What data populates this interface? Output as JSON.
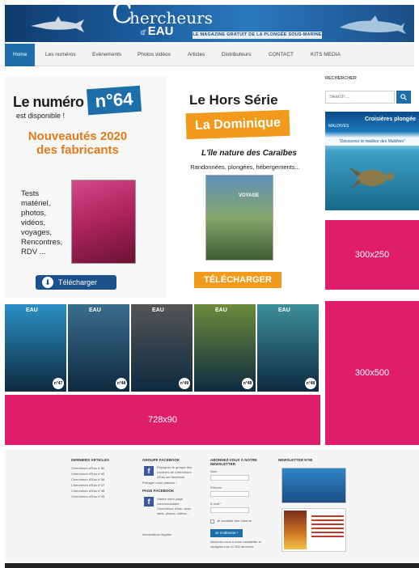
{
  "header": {
    "logo_c": "C",
    "logo_top": "hercheurs",
    "logo_small": "d'",
    "logo_bottom": "EAU",
    "tagline": "LE MAGAZINE GRATUIT DE LA PLONGÉE SOUS-MARINE"
  },
  "nav": {
    "items": [
      {
        "label": "Home"
      },
      {
        "label": "Les numéros"
      },
      {
        "label": "Evénements"
      },
      {
        "label": "Photos vidéos"
      },
      {
        "label": "Articles"
      },
      {
        "label": "Distributeurs"
      },
      {
        "label": "CONTACT"
      },
      {
        "label": "KITS MEDIA"
      }
    ]
  },
  "promo1": {
    "title": "Le numéro",
    "number": "n°64",
    "available": "est disponible !",
    "headline": "Nouveautés 2020 des fabricants",
    "tests": "Tests matériel, photos, vidéos, voyages, Rencontres, RDV ...",
    "download": "Télécharger"
  },
  "promo2": {
    "title": "Le Hors Série",
    "destination": "La Dominique",
    "subtitle": "L'île nature des Caraïbes",
    "topics": "Randonnées, plongées, hébergements...",
    "cover_label": "VOYAGE",
    "download": "TÉLÉCHARGER"
  },
  "sidebar": {
    "search_title": "RECHERCHER",
    "search_placeholder": "Search ...",
    "maldives_title": "Croisières plongée",
    "maldives_sub": "MALDIVES",
    "maldives_band": "\"Découvrez le meilleur des Maldives\""
  },
  "ads": {
    "ad1": "300x250",
    "ad2": "300x500",
    "ad3": "728x90"
  },
  "covers": [
    {
      "logo": "EAU",
      "num": "n°47",
      "color": "#2a8fc4"
    },
    {
      "logo": "EAU",
      "num": "n°48",
      "color": "#3a6d8e"
    },
    {
      "logo": "EAU",
      "num": "n°49",
      "color": "#555555"
    },
    {
      "logo": "EAU",
      "num": "n°48",
      "color": "#6c8b3a"
    },
    {
      "logo": "EAU",
      "num": "n°48",
      "color": "#3c8f9a"
    }
  ],
  "footer": {
    "articles_title": "DERNIERS ARTICLES",
    "articles": [
      "Chercheurs d'Eau n°50",
      "Chercheurs d'Eau n°49",
      "Chercheurs d'Eau n°48",
      "Chercheurs d'Eau n°47",
      "Chercheurs d'Eau n°46",
      "Chercheurs d'Eau n°45"
    ],
    "fb_title": "GROUPE FACEBOOK",
    "fb_text": "Rejoignez le groupe des Lecteurs de Chercheurs d'Eau sur facebook",
    "fb_share": "Partager votre passion !",
    "page_title": "PAGE FACEBOOK",
    "page_text": "Visitez notre page communautaire Chercheurs d'eau, avec infos, photos, vidéos...",
    "legal": "Informations légales",
    "nl_title": "ABONNEZ-VOUS À NOTRE NEWSLETTER",
    "nl_name": "Nom",
    "nl_firstname": "Prénom",
    "nl_email": "E-mail *",
    "nl_consent": "Je souhaite être informé",
    "nl_button": "Je m'abonne !",
    "nl_note": "Abonnez-vous à notre newsletter et rejoignez nos 11 962 abonnés.",
    "newsletter_title": "NEWSLETTER N°50"
  }
}
